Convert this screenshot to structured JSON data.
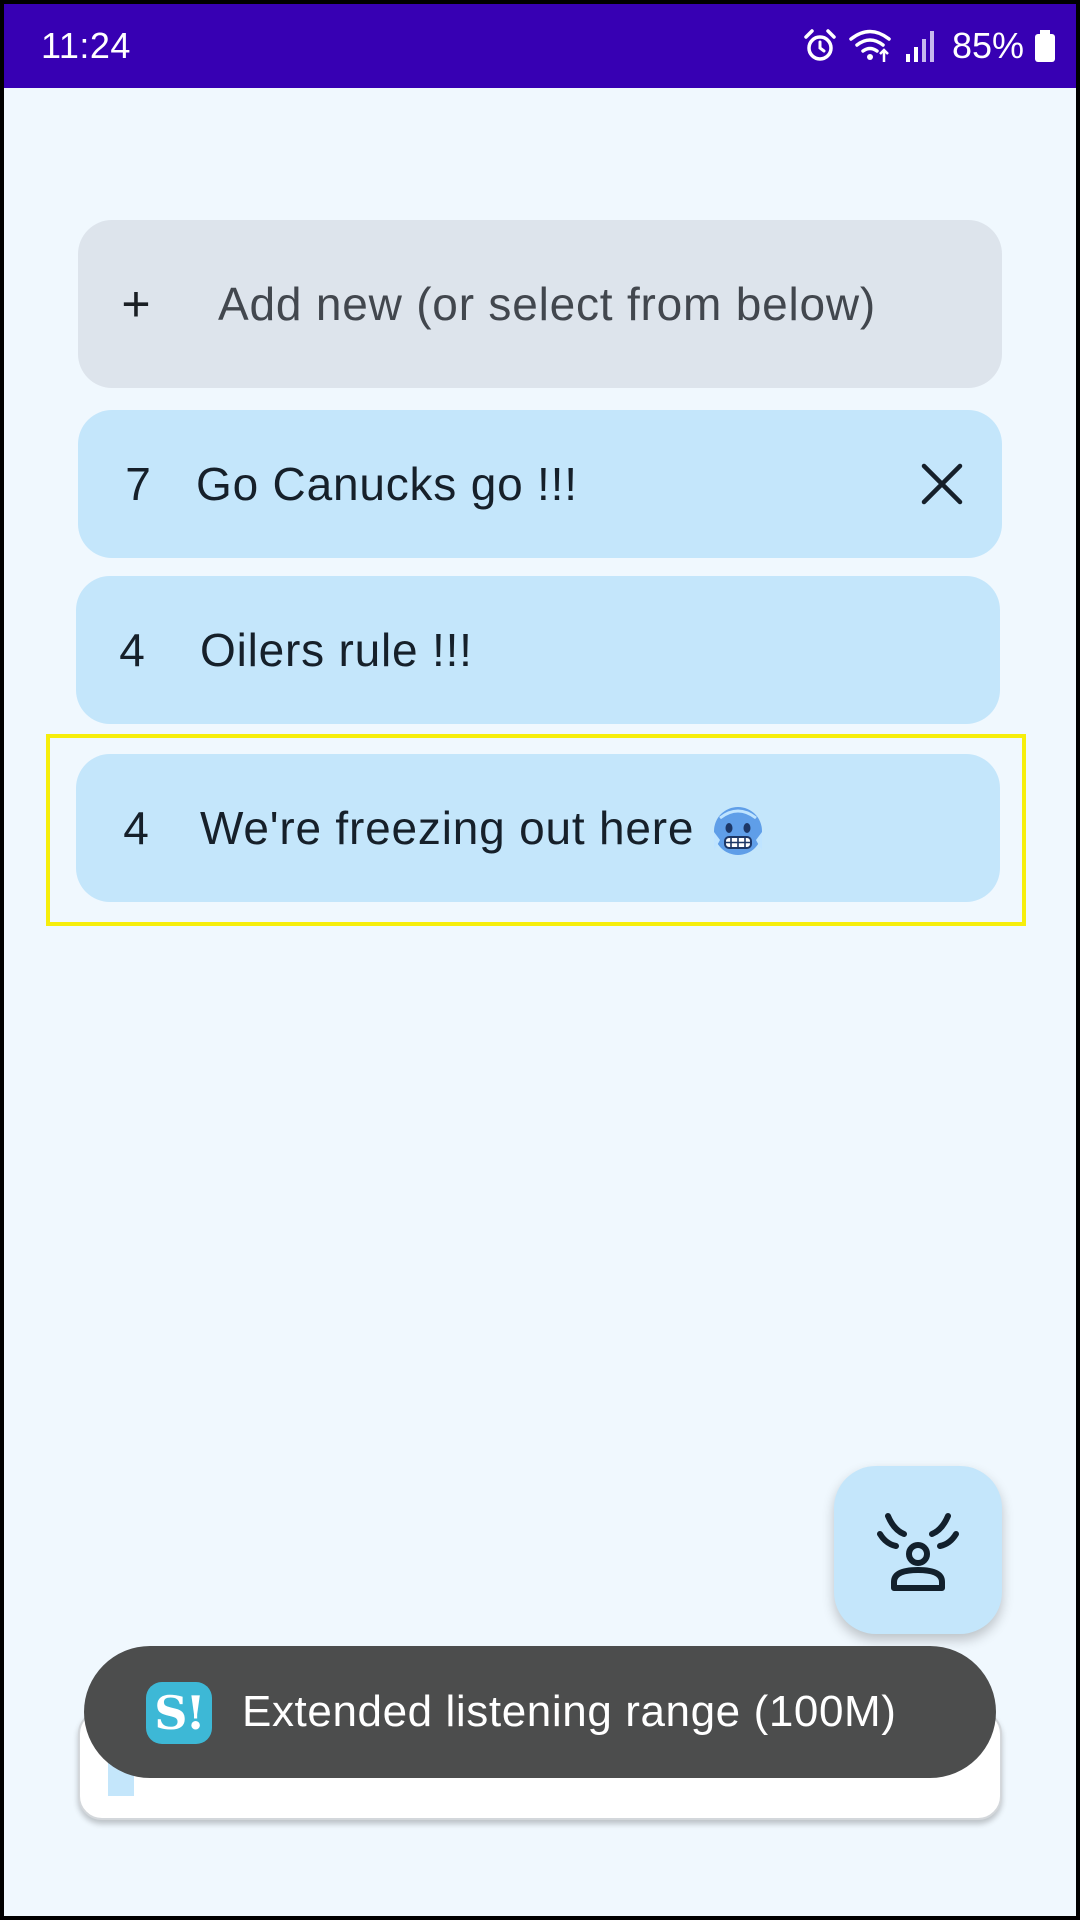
{
  "status_bar": {
    "time": "11:24",
    "battery_percent": "85%",
    "icons": [
      "alarm-icon",
      "wifi-icon",
      "signal-icon",
      "battery-icon"
    ],
    "background": "#3700b3"
  },
  "add_new": {
    "icon": "plus-icon",
    "plus_glyph": "+",
    "label": "Add new (or select from below)"
  },
  "phrases": [
    {
      "count": "7",
      "text": "Go Canucks go !!!",
      "has_delete": true
    },
    {
      "count": "4",
      "text": "Oilers rule !!!"
    },
    {
      "count": "4",
      "text": "We're freezing out here",
      "emoji": "cold-face-emoji",
      "highlighted": true
    }
  ],
  "fab": {
    "icon": "listening-person-icon"
  },
  "toast": {
    "logo_text": "S!",
    "message": "Extended listening range (100M)"
  },
  "input": {
    "value": ""
  },
  "colors": {
    "background": "#f0f8fe",
    "card": "#c4e6fb",
    "add_card": "#dde4ec",
    "toast": "#4c4d4d",
    "highlight": "#f6ee0c"
  }
}
